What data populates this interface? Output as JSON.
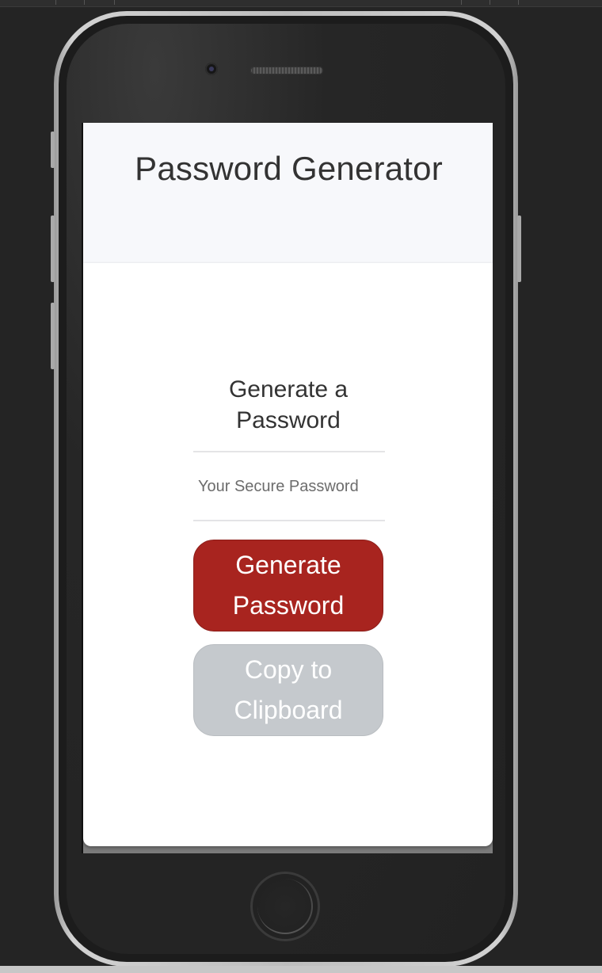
{
  "app": {
    "title": "Password Generator"
  },
  "card": {
    "heading": "Generate a Password",
    "password_placeholder": "Your Secure Password",
    "password_value": "",
    "generate_button_label": "Generate Password",
    "copy_button_label": "Copy to Clipboard"
  },
  "colors": {
    "generate_button": "#a8241f",
    "copy_button_disabled": "#c5c9cd",
    "header_background": "#f7f8fb",
    "card_background": "#ffffff",
    "device_background": "#242424"
  },
  "icons": {
    "camera": "front-camera-icon",
    "speaker": "earpiece-speaker-icon",
    "home": "home-button-icon"
  }
}
